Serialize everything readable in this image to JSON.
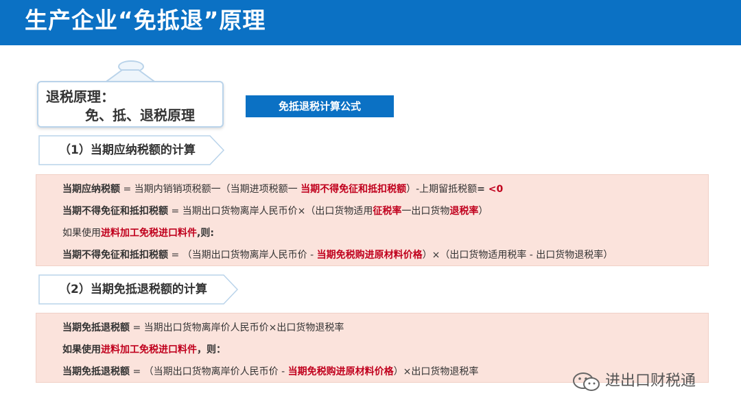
{
  "header": {
    "title": "生产企业“免抵退”原理"
  },
  "principle_box": {
    "line1": "退税原理：",
    "line2": "免、抵、退税原理"
  },
  "formula_button": "免抵退税计算公式",
  "sections": [
    {
      "heading": "（1）当期应纳税额的计算",
      "lines": [
        [
          {
            "t": "当期应纳税额",
            "s": "b"
          },
          {
            "t": " = 当期内销销项税额一（当期进项税额一 ",
            "s": "n"
          },
          {
            "t": "当期不得免征和抵扣税额",
            "s": "r"
          },
          {
            "t": "）-上期留抵税额",
            "s": "n"
          },
          {
            "t": "= ",
            "s": "b"
          },
          {
            "t": "<0",
            "s": "r"
          }
        ],
        [
          {
            "t": "当期不得免征和抵扣税额",
            "s": "b"
          },
          {
            "t": " = 当期出口货物离岸人民币价×（出口货物适用",
            "s": "n"
          },
          {
            "t": "征税率",
            "s": "r"
          },
          {
            "t": "一出口货物",
            "s": "n"
          },
          {
            "t": "退税率",
            "s": "r"
          },
          {
            "t": "）",
            "s": "n"
          }
        ],
        [
          {
            "t": "如果使用",
            "s": "n"
          },
          {
            "t": "进料加工免税进口料件",
            "s": "r"
          },
          {
            "t": ",则:",
            "s": "b"
          }
        ],
        [
          {
            "t": "当期不得免征和抵扣税额",
            "s": "b"
          },
          {
            "t": " = （当期出口货物离岸人民币价 - ",
            "s": "n"
          },
          {
            "t": "当期免税购进原材料价格",
            "s": "r"
          },
          {
            "t": "）×（出口货物适用税率 - 出口货物退税率）",
            "s": "n"
          }
        ]
      ]
    },
    {
      "heading": "（2）当期免抵退税额的计算",
      "lines": [
        [
          {
            "t": "当期免抵退税额",
            "s": "b"
          },
          {
            "t": " = 当期出口货物离岸价人民币价×出口货物退税率",
            "s": "n"
          }
        ],
        [
          {
            "t": "如果使用",
            "s": "b"
          },
          {
            "t": "进料加工免税进口料件",
            "s": "r"
          },
          {
            "t": "，则：",
            "s": "b"
          }
        ],
        [
          {
            "t": "当期免抵退税额",
            "s": "b"
          },
          {
            "t": " = （当期出口货物离岸价人民币价 - ",
            "s": "n"
          },
          {
            "t": "当期免税购进原材料价格",
            "s": "r"
          },
          {
            "t": "）×出口货物退税率",
            "s": "n"
          }
        ]
      ]
    }
  ],
  "watermark": {
    "text": "进出口财税通",
    "icon": "wechat-icon"
  },
  "colors": {
    "title_bar": "#0b71c4",
    "panel": "#fbe3dc",
    "emphasis": "#c0001d"
  }
}
